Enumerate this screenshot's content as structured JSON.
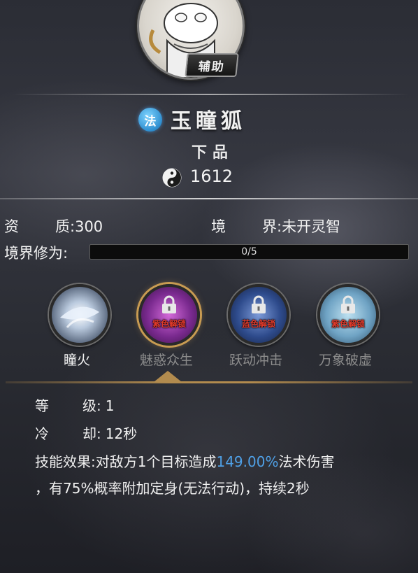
{
  "header": {
    "role_badge": "辅助"
  },
  "pet": {
    "type_icon_label": "法",
    "name": "玉瞳狐",
    "grade": "下品",
    "power": "1612"
  },
  "stats": {
    "zizhi_label_a": "资",
    "zizhi_label_b": "质:",
    "zizhi_value": "300",
    "jingjie_label_a": "境",
    "jingjie_label_b": "界:",
    "jingjie_value": "未开灵智"
  },
  "realm": {
    "label": "境界修为:",
    "progress_text": "0/5",
    "progress_current": 0,
    "progress_max": 5,
    "bar_fill_color": "#6aa1d8"
  },
  "skills": [
    {
      "name": "瞳火",
      "locked": false,
      "lock_text": "",
      "icon": "eye-fire-icon"
    },
    {
      "name": "魅惑众生",
      "locked": true,
      "lock_text": "紫色解锁",
      "icon": "lock-icon"
    },
    {
      "name": "跃动冲击",
      "locked": true,
      "lock_text": "蓝色解锁",
      "icon": "lock-icon"
    },
    {
      "name": "万象破虚",
      "locked": true,
      "lock_text": "紫色解锁",
      "icon": "lock-icon"
    }
  ],
  "detail": {
    "level_label_a": "等",
    "level_label_b": "级:",
    "level_value": "1",
    "cooldown_label_a": "冷",
    "cooldown_label_b": "却:",
    "cooldown_value": "12秒",
    "effect_label": "技能效果:",
    "effect_text_1": "对敌方1个目标造成",
    "effect_highlight": "149.00%",
    "effect_text_2": "法术伤害",
    "effect_text_3": "，有75%概率附加定身(无法行动)，持续2秒"
  },
  "colors": {
    "highlight": "#4fa0e6",
    "lock_text": "#e03a2a",
    "selected_border": "#c89b52"
  }
}
